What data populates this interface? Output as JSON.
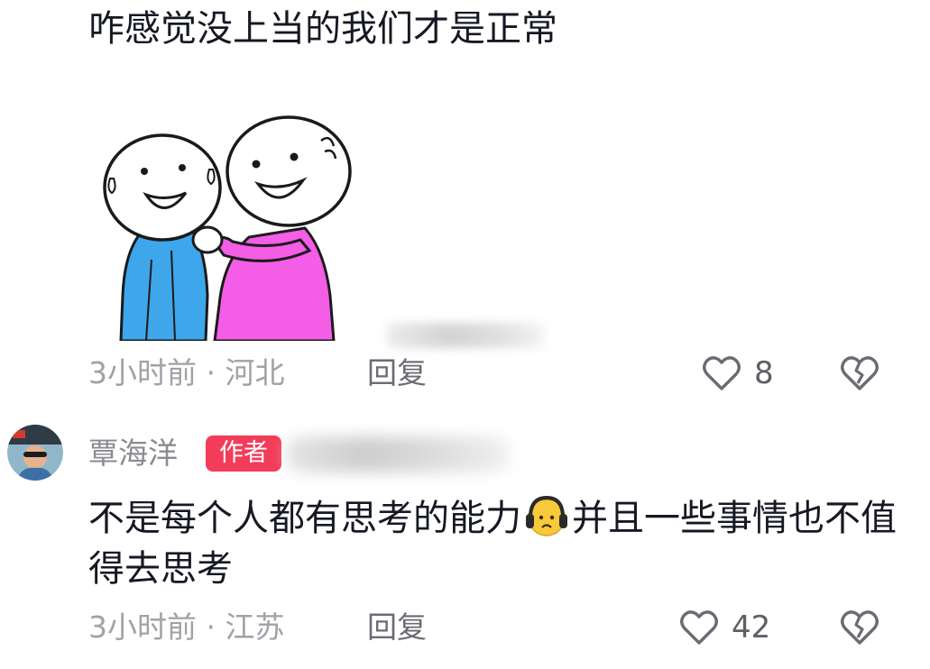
{
  "comments": [
    {
      "text": "咋感觉没上当的我们才是正常",
      "sticker": "two-stickman-friends-hugging-sticker",
      "meta": "3小时前 · 河北",
      "reply_label": "回复",
      "likes": "8"
    },
    {
      "username": "覃海洋",
      "author_badge": "作者",
      "text_part1": "不是每个人都有思考的能力",
      "emoji": "headphones-sad-face-emoji",
      "text_part2": "并且一些事情也不值得去思考",
      "meta": "3小时前 · 江苏",
      "reply_label": "回复",
      "likes": "42"
    }
  ],
  "colors": {
    "text": "#161823",
    "meta": "#a1a2a7",
    "author_badge": "#f23c5a",
    "sticker_blue": "#3ea7ec",
    "sticker_pink": "#f45de6"
  }
}
